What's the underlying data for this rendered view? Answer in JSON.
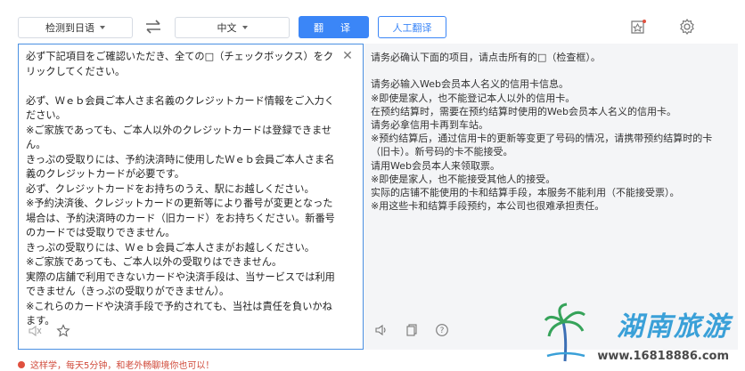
{
  "toolbar": {
    "source_lang": "检测到日语",
    "target_lang": "中文",
    "translate_label": "翻　译",
    "human_translate_label": "人工翻译",
    "icons": [
      "swap-icon",
      "favorite-icon",
      "settings-icon"
    ]
  },
  "source": {
    "text": "必ず下記項目をご確認いただき、全ての□（チェックボックス）をクリックしてください。\n\n必ず、Ｗｅｂ会員ご本人さま名義のクレジットカード情報をご入力ください。\n※ご家族であっても、ご本人以外のクレジットカードは登録できません。\nきっぷの受取りには、予約決済時に使用したＷｅｂ会員ご本人さま名義のクレジットカードが必要です。\n必ず、クレジットカードをお持ちのうえ、駅にお越しください。\n※予約決済後、クレジットカードの更新等により番号が変更となった場合は、予約決済時のカード（旧カード）をお持ちください。新番号のカードでは受取りできません。\nきっぷの受取りには、Ｗｅｂ会員ご本人さまがお越しください。\n※ご家族であっても、ご本人以外の受取りはできません。\n実際の店舗で利用できないカードや決済手段は、当サービスでは利用できません（きっぷの受取りができません）。\n※これらのカードや決済手段で予約されても、当社は責任を負いかねます。",
    "icons": [
      "clear-icon",
      "speaker-off-icon",
      "star-icon"
    ]
  },
  "target": {
    "text": "请务必确认下面的项目，请点击所有的□（检查框）。\n\n请务必输入Web会员本人名义的信用卡信息。\n※即使是家人，也不能登记本人以外的信用卡。\n在预约结算时，需要在预约结算时使用的Web会员本人名义的信用卡。\n请务必拿信用卡再到车站。\n※预约结算后，通过信用卡的更新等变更了号码的情况，请携带预约结算时的卡（旧卡）。新号码的卡不能接受。\n请用Web会员本人来领取票。\n※即使是家人，也不能接受其他人的接受。\n实际的店铺不能使用的卡和结算手段，本服务不能利用（不能接受票）。\n※用这些卡和结算手段预约，本公司也很难承担责任。",
    "icons": [
      "speaker-icon",
      "copy-icon",
      "help-icon"
    ]
  },
  "footer": {
    "note": "这样学，每天5分钟，和老外畅聊境你也可以！"
  },
  "watermark": {
    "title": "湖南旅游",
    "url": "www.16818886.com"
  },
  "colors": {
    "accent": "#3b86f7",
    "panel_border": "#4a90e2",
    "target_bg": "#f4f5f7"
  }
}
